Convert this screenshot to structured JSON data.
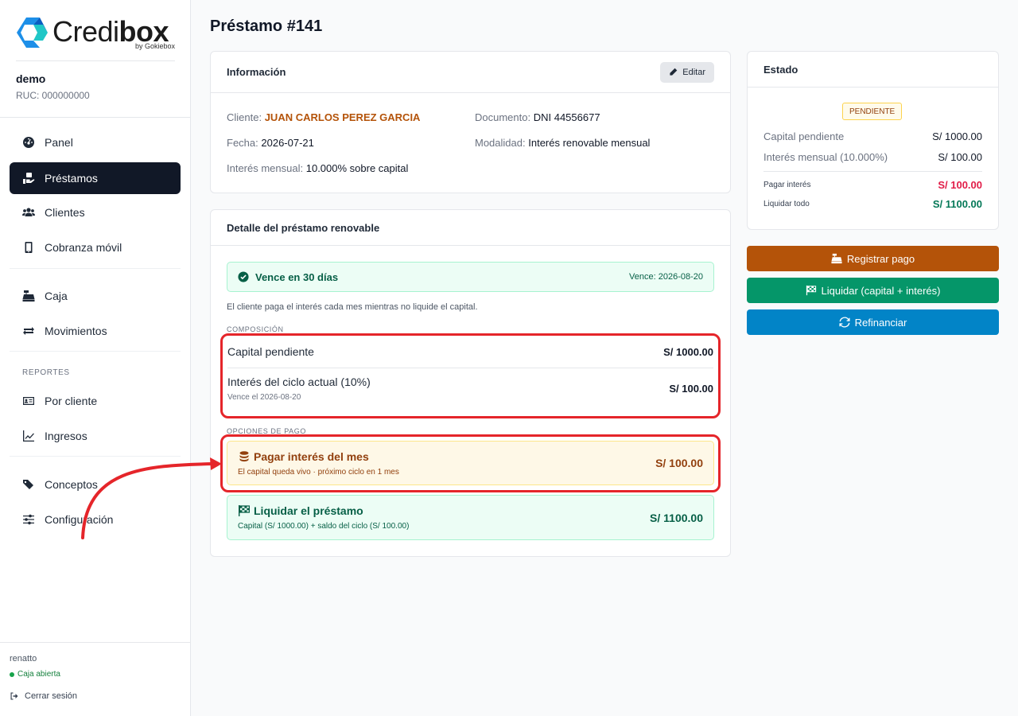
{
  "brand": {
    "name_light": "Credi",
    "name_bold": "box",
    "by": "by Gokiebox"
  },
  "org": {
    "name": "demo",
    "ruc": "RUC: 000000000"
  },
  "nav": {
    "panel": "Panel",
    "prestamos": "Préstamos",
    "clientes": "Clientes",
    "cobranza": "Cobranza móvil",
    "caja": "Caja",
    "movimientos": "Movimientos",
    "reportes_section": "REPORTES",
    "por_cliente": "Por cliente",
    "ingresos": "Ingresos",
    "conceptos": "Conceptos",
    "configuracion": "Configuración"
  },
  "footer": {
    "user": "renatto",
    "caja_status": "Caja abierta",
    "logout": "Cerrar sesión"
  },
  "page": {
    "title": "Préstamo #141"
  },
  "info_card": {
    "title": "Información",
    "edit_label": "Editar",
    "cliente_label": "Cliente:",
    "cliente_value": "JUAN CARLOS PEREZ GARCIA",
    "documento_label": "Documento:",
    "documento_value": "DNI 44556677",
    "fecha_label": "Fecha:",
    "fecha_value": "2026-07-21",
    "modalidad_label": "Modalidad:",
    "modalidad_value": "Interés renovable mensual",
    "interes_label": "Interés mensual:",
    "interes_value": "10.000% sobre capital"
  },
  "detail_card": {
    "title": "Detalle del préstamo renovable",
    "due_text": "Vence en 30 días",
    "due_date": "Vence: 2026-08-20",
    "note": "El cliente paga el interés cada mes mientras no liquide el capital.",
    "composicion_label": "COMPOSICIÓN",
    "capital_label": "Capital pendiente",
    "capital_value": "S/ 1000.00",
    "interes_ciclo_label": "Interés del ciclo actual (10%)",
    "interes_ciclo_sub": "Vence el 2026-08-20",
    "interes_ciclo_value": "S/ 100.00",
    "opciones_label": "OPCIONES DE PAGO",
    "opt_interest_title": "Pagar interés del mes",
    "opt_interest_sub": "El capital queda vivo · próximo ciclo en 1 mes",
    "opt_interest_amount": "S/ 100.00",
    "opt_settle_title": "Liquidar el préstamo",
    "opt_settle_sub": "Capital (S/ 1000.00) + saldo del ciclo (S/ 100.00)",
    "opt_settle_amount": "S/ 1100.00"
  },
  "status_card": {
    "title": "Estado",
    "badge": "PENDIENTE",
    "capital_label": "Capital pendiente",
    "capital_value": "S/ 1000.00",
    "interes_label": "Interés mensual (10.000%)",
    "interes_value": "S/ 100.00",
    "pagar_label": "Pagar interés",
    "pagar_value": "S/ 100.00",
    "liquidar_label": "Liquidar todo",
    "liquidar_value": "S/ 1100.00"
  },
  "actions": {
    "registrar": "Registrar pago",
    "liquidar": "Liquidar (capital + interés)",
    "refinanciar": "Refinanciar"
  },
  "colors": {
    "sidebar_active": "#111827",
    "client_name": "#b45309",
    "btn_registrar": "#b45309",
    "btn_liquidar": "#059669",
    "btn_refinanciar": "#0284c7",
    "annotation": "#e5252a"
  }
}
